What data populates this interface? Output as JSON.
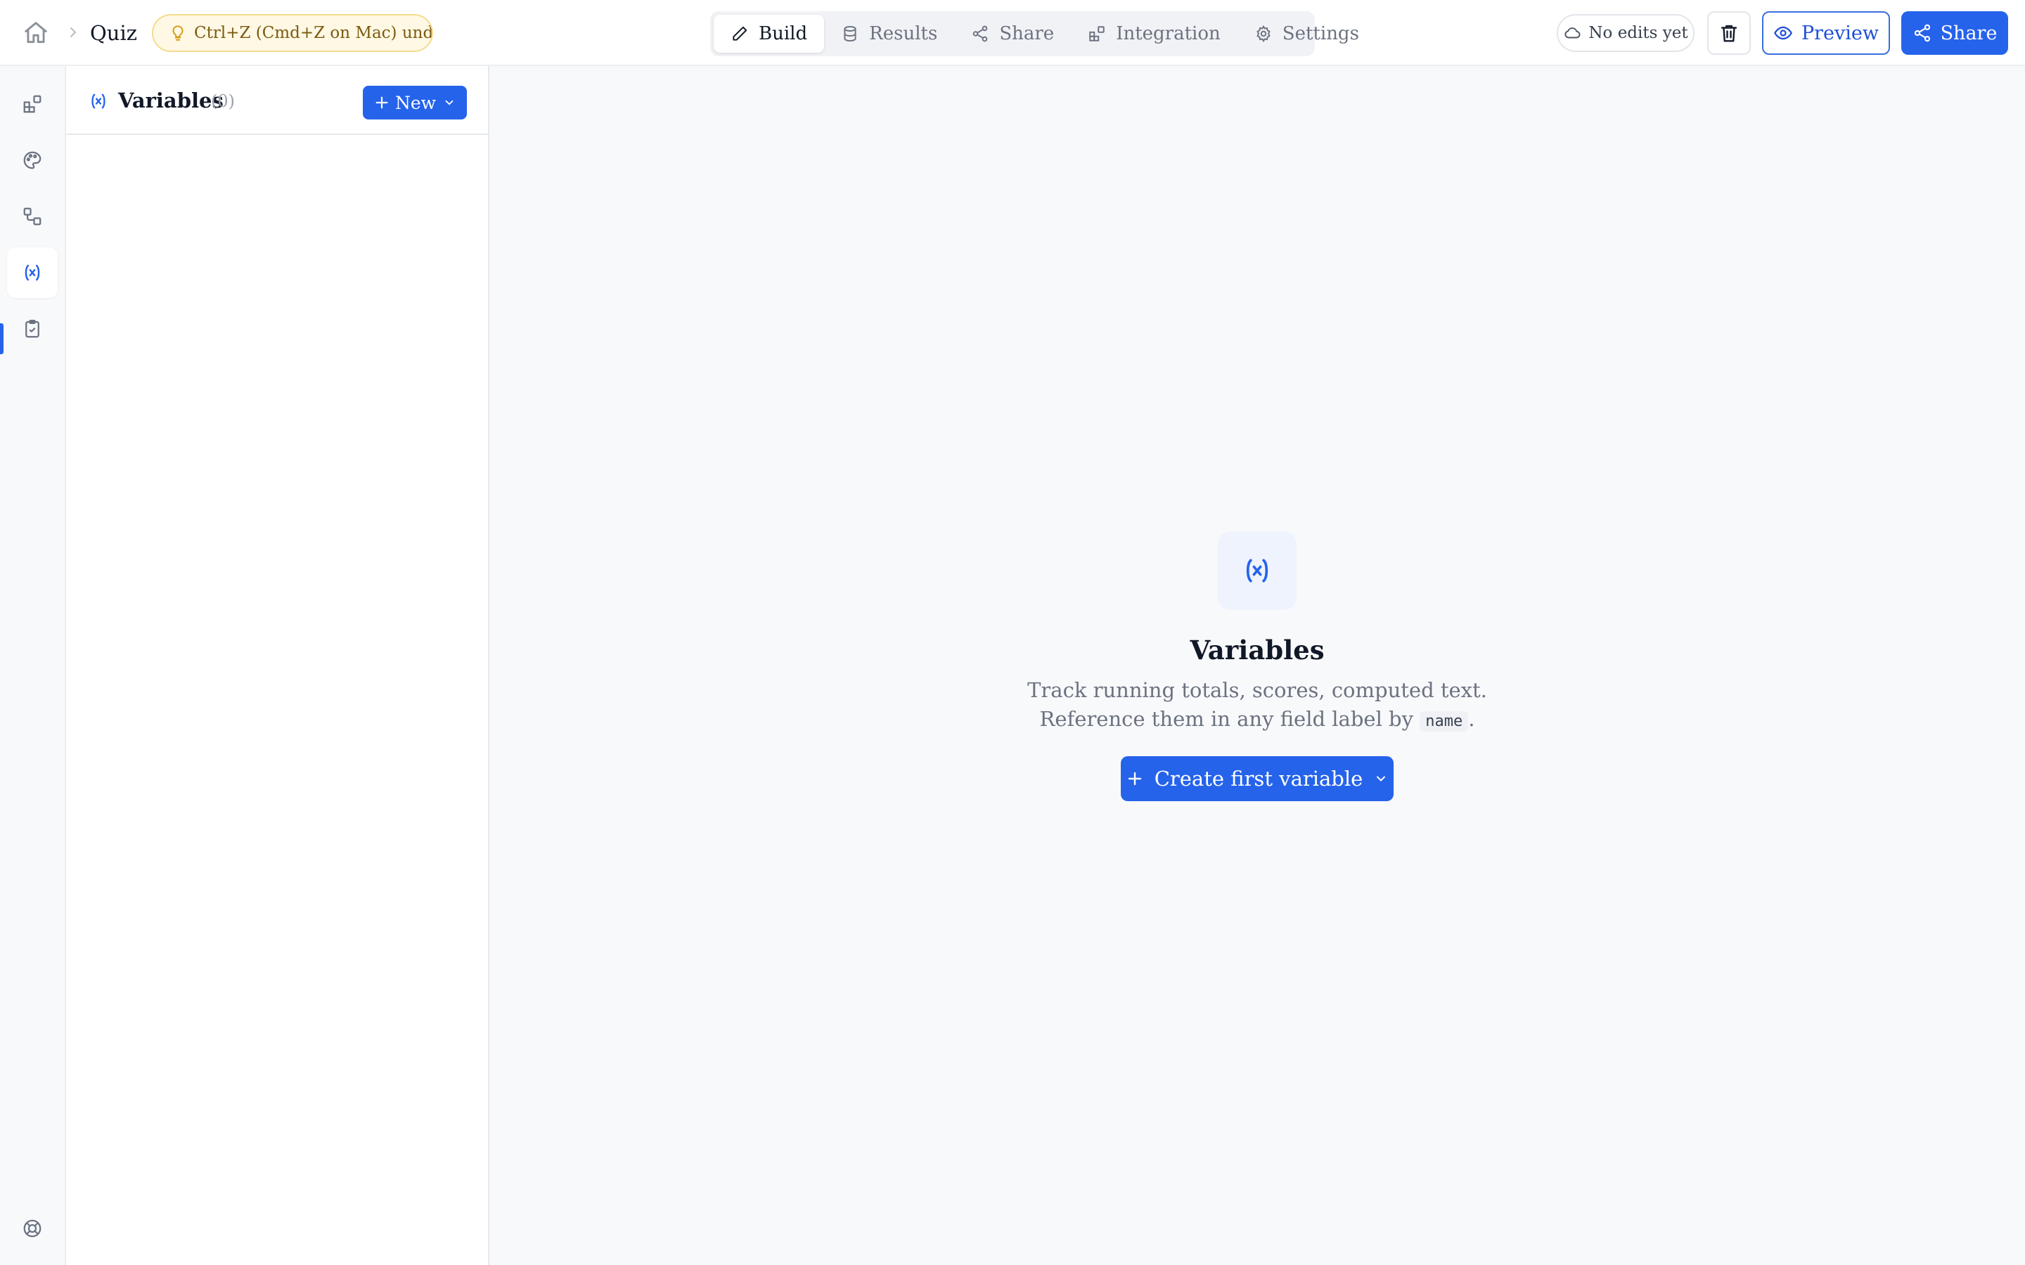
{
  "breadcrumb": {
    "home_icon": "home-icon",
    "separator_icon": "chevron-right-icon",
    "title": "Quiz"
  },
  "tip": {
    "icon": "lightbulb-icon",
    "text": "Ctrl+Z (Cmd+Z on Mac) undo..."
  },
  "tabs": [
    {
      "label": "Build",
      "icon": "pencil-icon",
      "active": true
    },
    {
      "label": "Results",
      "icon": "database-icon",
      "active": false
    },
    {
      "label": "Share",
      "icon": "share-icon",
      "active": false
    },
    {
      "label": "Integration",
      "icon": "blocks-icon",
      "active": false
    },
    {
      "label": "Settings",
      "icon": "gear-icon",
      "active": false
    }
  ],
  "toolbar": {
    "status_label": "No edits yet",
    "status_icon": "cloud-icon",
    "delete_icon": "trash-icon",
    "preview_label": "Preview",
    "preview_icon": "eye-icon",
    "share_label": "Share",
    "share_icon": "share-icon"
  },
  "rail": {
    "items": [
      {
        "name": "blocks",
        "icon": "blocks-icon",
        "active": false
      },
      {
        "name": "theme",
        "icon": "palette-icon",
        "active": false
      },
      {
        "name": "logic",
        "icon": "workflow-icon",
        "active": false
      },
      {
        "name": "variables",
        "icon": "variable-icon",
        "active": true
      },
      {
        "name": "checklist",
        "icon": "clipboard-check-icon",
        "active": false
      }
    ],
    "help_icon": "lifebuoy-icon"
  },
  "variables_panel": {
    "title": "Variables",
    "count": "(0)",
    "new_button_label": "New"
  },
  "empty_state": {
    "icon": "variable-icon",
    "title": "Variables",
    "description_prefix": "Track running totals, scores, computed text. Reference them in any field label by",
    "code_token": "name",
    "description_suffix": ".",
    "button_label": "Create first variable"
  },
  "colors": {
    "accent": "#2563eb",
    "tip_background": "#fef8e4",
    "tip_border": "#f6dc8e",
    "page_background": "#f8f9fb"
  }
}
